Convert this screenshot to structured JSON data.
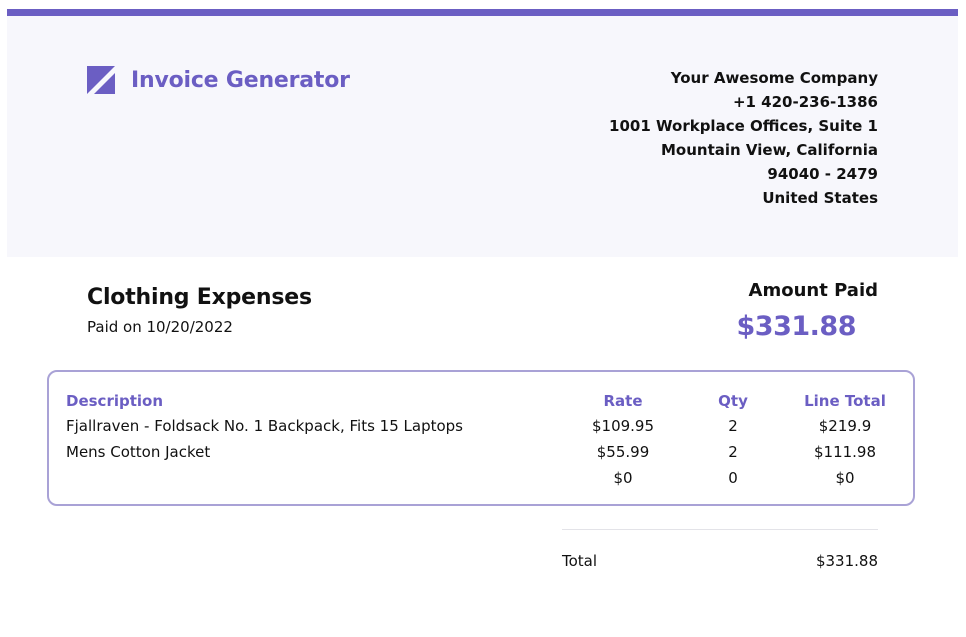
{
  "colors": {
    "accent": "#6b5ec3",
    "header_bg": "#f7f7fc",
    "text": "#111111",
    "table_border": "#a9a2d6"
  },
  "brand": {
    "icon": "invoice-generator-logo-icon",
    "title": "Invoice Generator"
  },
  "company": {
    "name": "Your Awesome Company",
    "phone": "+1 420-236-1386",
    "address_line1": "1001 Workplace Offices, Suite 1",
    "city_state": "Mountain View, California",
    "zip": "94040 - 2479",
    "country": "United States"
  },
  "invoice": {
    "title": "Clothing Expenses",
    "paid_on": "Paid on 10/20/2022",
    "amount_label": "Amount Paid",
    "amount_value": "$331.88"
  },
  "table": {
    "headers": {
      "description": "Description",
      "rate": "Rate",
      "qty": "Qty",
      "line_total": "Line Total"
    },
    "rows": [
      {
        "description": "Fjallraven - Foldsack No. 1 Backpack, Fits 15 Laptops",
        "rate": "$109.95",
        "qty": "2",
        "line_total": "$219.9"
      },
      {
        "description": "Mens Cotton Jacket",
        "rate": "$55.99",
        "qty": "2",
        "line_total": "$111.98"
      },
      {
        "description": "",
        "rate": "$0",
        "qty": "0",
        "line_total": "$0"
      }
    ]
  },
  "totals": {
    "label": "Total",
    "value": "$331.88"
  }
}
